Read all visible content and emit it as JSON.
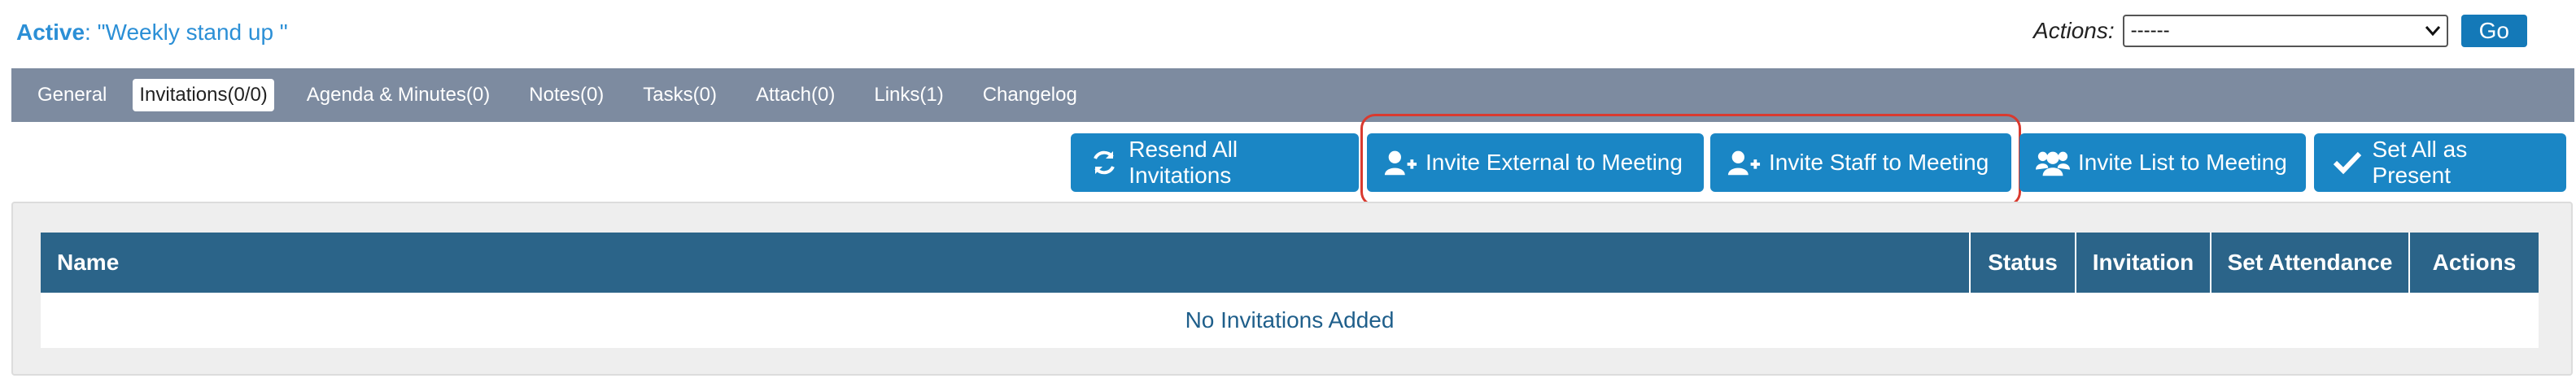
{
  "header": {
    "active_label": "Active",
    "active_title": ": \"Weekly stand up \"",
    "actions_label": "Actions:",
    "actions_select_value": "------",
    "go_label": "Go"
  },
  "tabs": [
    {
      "label": "General"
    },
    {
      "label": "Invitations(0/0)"
    },
    {
      "label": "Agenda & Minutes(0)"
    },
    {
      "label": "Notes(0)"
    },
    {
      "label": "Tasks(0)"
    },
    {
      "label": "Attach(0)"
    },
    {
      "label": "Links(1)"
    },
    {
      "label": "Changelog"
    }
  ],
  "buttons": {
    "resend": "Resend All Invitations",
    "invite_external": "Invite External to Meeting",
    "invite_staff": "Invite Staff to Meeting",
    "invite_list": "Invite List to Meeting",
    "set_present": "Set All as Present"
  },
  "table": {
    "columns": [
      "Name",
      "Status",
      "Invitation",
      "Set Attendance",
      "Actions"
    ],
    "empty_message": "No Invitations Added"
  },
  "colors": {
    "accent": "#1a86c5",
    "tabbar": "#7d8ba0",
    "table_header": "#2b6489",
    "highlight": "#d93a2f"
  },
  "icons": {
    "resend": "refresh-icon",
    "invite_external": "user-plus-icon",
    "invite_staff": "user-plus-icon",
    "invite_list": "users-icon",
    "set_present": "check-icon"
  }
}
